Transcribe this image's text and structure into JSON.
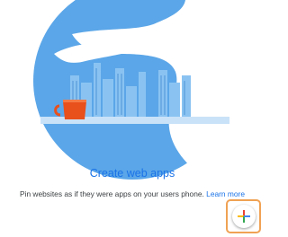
{
  "empty_state": {
    "heading": "Create web apps",
    "description": "Pin websites as if they were apps on your users phone.",
    "learn_more_link": "Learn more"
  },
  "add_button": {
    "icon": "plus-icon",
    "colors": [
      "#ea4335",
      "#fbbc04",
      "#34a853",
      "#4285f4"
    ]
  },
  "illustration": {
    "subject": "coffee cup with steam over city skyline",
    "colors": {
      "circle": "#5ba6e8",
      "buildings": "#8ac3f2",
      "cup": "#e8501c"
    }
  }
}
